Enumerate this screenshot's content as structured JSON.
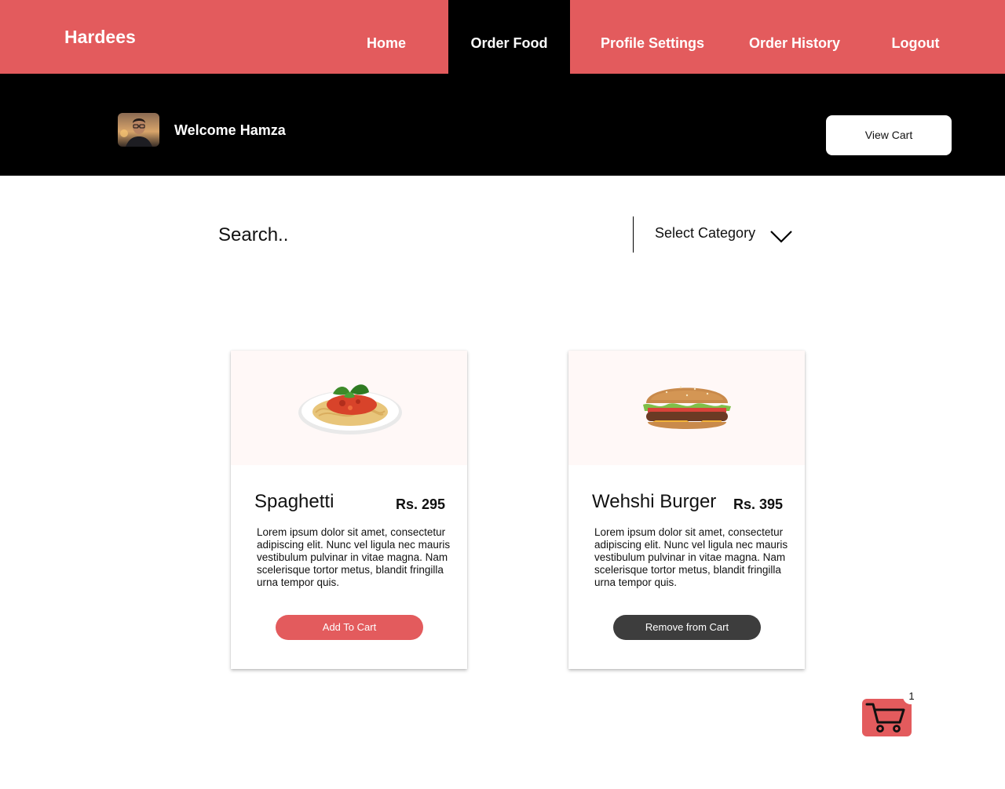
{
  "nav": {
    "brand": "Hardees",
    "items": [
      {
        "label": "Home"
      },
      {
        "label": "Order Food",
        "active": true
      },
      {
        "label": "Profile Settings"
      },
      {
        "label": "Order History"
      },
      {
        "label": "Logout"
      }
    ],
    "bar_color": "#e35b5d",
    "active_color": "#000000"
  },
  "welcome": {
    "text": "Welcome Hamza",
    "view_cart_label": "View Cart"
  },
  "search": {
    "placeholder": "Search..",
    "category_label": "Select Category"
  },
  "products": [
    {
      "name": "Spaghetti",
      "price": "Rs. 295",
      "description": "Lorem ipsum dolor sit amet, consectetur adipiscing elit. Nunc vel ligula nec mauris vestibulum pulvinar in vitae magna. Nam scelerisque tortor metus, blandit fringilla urna tempor quis.",
      "button_label": "Add To Cart",
      "image": "spaghetti-plate"
    },
    {
      "name": "Wehshi Burger",
      "price": "Rs. 395",
      "description": "Lorem ipsum dolor sit amet, consectetur adipiscing elit. Nunc vel ligula nec mauris vestibulum pulvinar in vitae magna. Nam scelerisque tortor metus, blandit fringilla urna tempor quis.",
      "button_label": "Remove from Cart",
      "image": "burger"
    }
  ],
  "cart": {
    "count": "1",
    "icon": "shopping-cart-icon",
    "button_color": "#e35b5d",
    "remove_button_color": "#3d3d3d"
  }
}
